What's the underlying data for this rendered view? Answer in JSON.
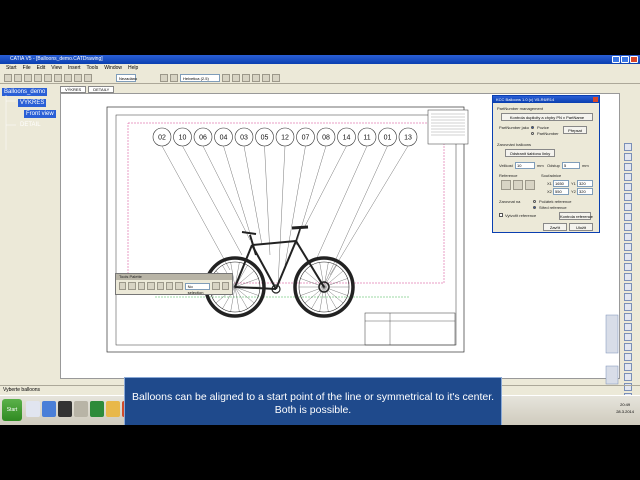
{
  "window": {
    "title": "CATIA V5 - [Balloons_demo.CATDrawing]",
    "menu": [
      "Start",
      "File",
      "Edit",
      "View",
      "Insert",
      "Tools",
      "Window",
      "Help"
    ],
    "toolbar_select": "Nezadáno",
    "toolbar_select2": "Helvetica (2.5)"
  },
  "tabs": [
    "VÝKRES",
    "DETAILY"
  ],
  "tree": {
    "root": "Balloons_demo",
    "nodes": [
      "VYKRES",
      "Front view",
      "DETAIL"
    ]
  },
  "balloons": [
    "02",
    "10",
    "06",
    "04",
    "03",
    "05",
    "12",
    "07",
    "08",
    "14",
    "11",
    "01",
    "13"
  ],
  "float_toolbar": {
    "title": "Tools Palette",
    "select_value": "No selection"
  },
  "dialog": {
    "title": "KCC Balloons 1.0 (c) V5-R6/R14",
    "section1": "PartNumber management",
    "btn_control": "Kontrola duplicity a chyby PN v PartName",
    "pn_label": "PartNumber jako",
    "opt_poloze": "Pozice",
    "opt_partnumber": "PartNumber",
    "btn_prepsat": "Přepsat",
    "section2": "Zarovnání balloons",
    "btn_delete": "Odstranit šablonu linky",
    "velikost_label": "Velikost",
    "velikost_value": "10",
    "mm1": "mm",
    "odstup_label": "Odstup",
    "odstup_value": "5",
    "mm2": "mm",
    "reference_label": "Reference",
    "souradnice_label": "Souřadnice",
    "x1_label": "X1",
    "x1_value": "1650",
    "y1_label": "Y1",
    "y1_value": "320",
    "x2_label": "X2",
    "x2_value": "550",
    "y2_label": "Y2",
    "y2_value": "320",
    "zarovnat_label": "Zarovnat na",
    "opt_pocatek": "Počátek reference",
    "opt_stred": "Střed reference",
    "chk_vytvorit": "Vytvořit reference",
    "btn_kontrola": "Kontrola reference",
    "btn_zavrit": "Zavřít",
    "btn_ulozit": "Uložit"
  },
  "status": "Vyberte balloons",
  "taskbar": {
    "start": "Start",
    "time": "20:49",
    "date": "28.3.2014"
  },
  "caption": "Balloons can be aligned to a start point of the line or symmetrical to it's center. Both is possible.",
  "colors": {
    "accent": "#0a3fb0",
    "caption_bg": "#1f4a8c",
    "tree_bg": "#2a5fd6"
  }
}
